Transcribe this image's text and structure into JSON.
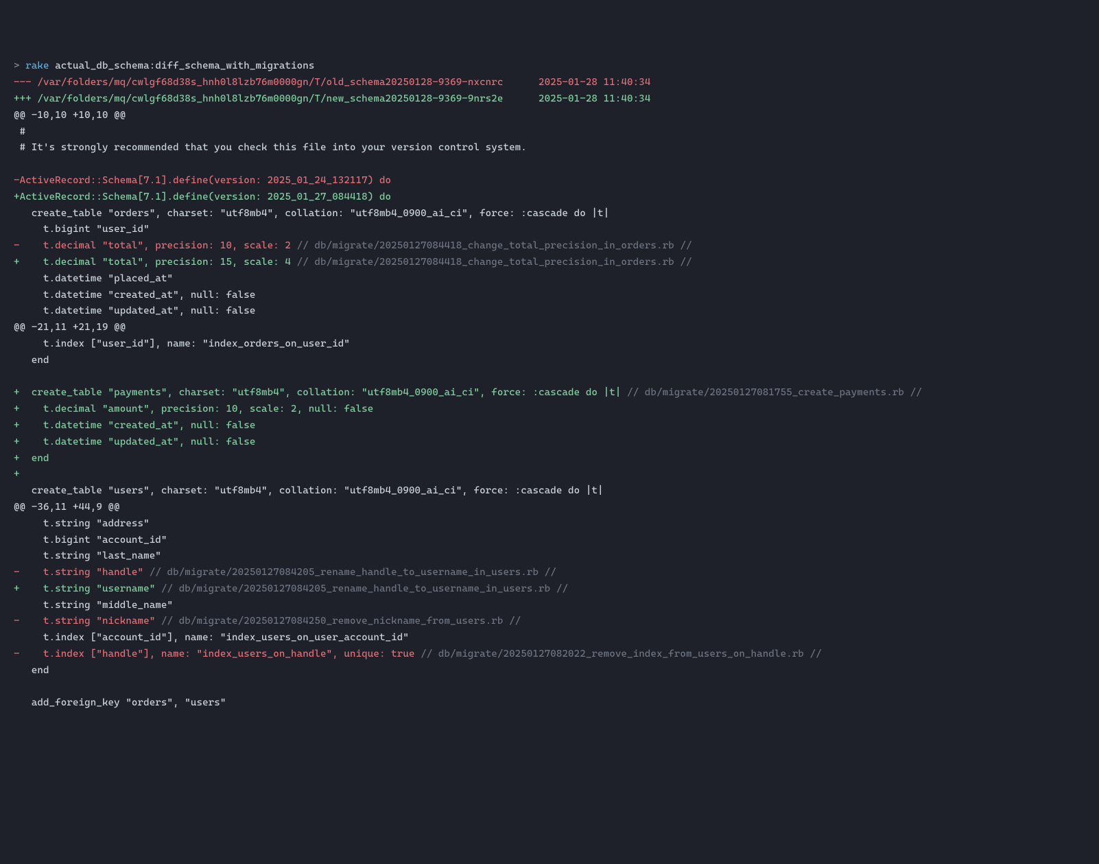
{
  "command": {
    "prompt": "> ",
    "rake": "rake",
    "args": " actual_db_schema:diff_schema_with_migrations"
  },
  "lines": [
    {
      "type": "red",
      "text": "--- /var/folders/mq/cwlgf68d38s_hnh0l8lzb76m0000gn/T/old_schema20250128-9369-nxcnrc      2025-01-28 11:40:34"
    },
    {
      "type": "green",
      "text": "+++ /var/folders/mq/cwlgf68d38s_hnh0l8lzb76m0000gn/T/new_schema20250128-9369-9nrs2e      2025-01-28 11:40:34"
    },
    {
      "type": "ctx",
      "text": "@@ -10,10 +10,10 @@"
    },
    {
      "type": "ctx",
      "text": " #"
    },
    {
      "type": "ctx",
      "text": " # It's strongly recommended that you check this file into your version control system."
    },
    {
      "type": "ctx",
      "text": ""
    },
    {
      "type": "red",
      "text": "-ActiveRecord::Schema[7.1].define(version: 2025_01_24_132117) do"
    },
    {
      "type": "green",
      "text": "+ActiveRecord::Schema[7.1].define(version: 2025_01_27_084418) do"
    },
    {
      "type": "ctx",
      "text": "   create_table \"orders\", charset: \"utf8mb4\", collation: \"utf8mb4_0900_ai_ci\", force: :cascade do |t|"
    },
    {
      "type": "ctx",
      "text": "     t.bigint \"user_id\""
    },
    {
      "type": "redcomment",
      "main": "-    t.decimal \"total\", precision: 10, scale: 2",
      "comment": " // db/migrate/20250127084418_change_total_precision_in_orders.rb //"
    },
    {
      "type": "greencomment",
      "main": "+    t.decimal \"total\", precision: 15, scale: 4",
      "comment": " // db/migrate/20250127084418_change_total_precision_in_orders.rb //"
    },
    {
      "type": "ctx",
      "text": "     t.datetime \"placed_at\""
    },
    {
      "type": "ctx",
      "text": "     t.datetime \"created_at\", null: false"
    },
    {
      "type": "ctx",
      "text": "     t.datetime \"updated_at\", null: false"
    },
    {
      "type": "ctx",
      "text": "@@ -21,11 +21,19 @@"
    },
    {
      "type": "ctx",
      "text": "     t.index [\"user_id\"], name: \"index_orders_on_user_id\""
    },
    {
      "type": "ctx",
      "text": "   end"
    },
    {
      "type": "ctx",
      "text": ""
    },
    {
      "type": "greencomment",
      "main": "+  create_table \"payments\", charset: \"utf8mb4\", collation: \"utf8mb4_0900_ai_ci\", force: :cascade do |t|",
      "comment": " // db/migrate/20250127081755_create_payments.rb //"
    },
    {
      "type": "green",
      "text": "+    t.decimal \"amount\", precision: 10, scale: 2, null: false"
    },
    {
      "type": "green",
      "text": "+    t.datetime \"created_at\", null: false"
    },
    {
      "type": "green",
      "text": "+    t.datetime \"updated_at\", null: false"
    },
    {
      "type": "green",
      "text": "+  end"
    },
    {
      "type": "green",
      "text": "+"
    },
    {
      "type": "ctx",
      "text": "   create_table \"users\", charset: \"utf8mb4\", collation: \"utf8mb4_0900_ai_ci\", force: :cascade do |t|"
    },
    {
      "type": "ctx",
      "text": "@@ -36,11 +44,9 @@"
    },
    {
      "type": "ctx",
      "text": "     t.string \"address\""
    },
    {
      "type": "ctx",
      "text": "     t.bigint \"account_id\""
    },
    {
      "type": "ctx",
      "text": "     t.string \"last_name\""
    },
    {
      "type": "redcomment",
      "main": "-    t.string \"handle\"",
      "comment": " // db/migrate/20250127084205_rename_handle_to_username_in_users.rb //"
    },
    {
      "type": "greencomment",
      "main": "+    t.string \"username\"",
      "comment": " // db/migrate/20250127084205_rename_handle_to_username_in_users.rb //"
    },
    {
      "type": "ctx",
      "text": "     t.string \"middle_name\""
    },
    {
      "type": "redcomment",
      "main": "-    t.string \"nickname\"",
      "comment": " // db/migrate/20250127084250_remove_nickname_from_users.rb //"
    },
    {
      "type": "ctx",
      "text": "     t.index [\"account_id\"], name: \"index_users_on_user_account_id\""
    },
    {
      "type": "redcomment",
      "main": "-    t.index [\"handle\"], name: \"index_users_on_handle\", unique: true",
      "comment": " // db/migrate/20250127082022_remove_index_from_users_on_handle.rb //"
    },
    {
      "type": "ctx",
      "text": "   end"
    },
    {
      "type": "ctx",
      "text": ""
    },
    {
      "type": "ctx",
      "text": "   add_foreign_key \"orders\", \"users\""
    }
  ]
}
